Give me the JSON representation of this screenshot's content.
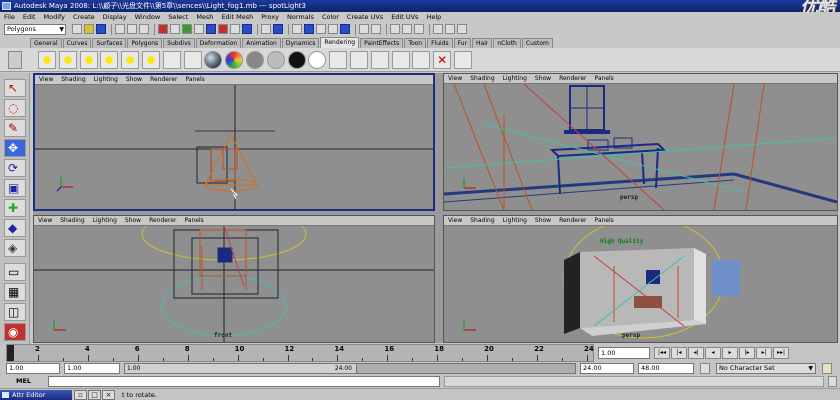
{
  "window": {
    "title": "Autodesk Maya 2008: L:\\\\顧子\\\\光盘文件\\\\第5章\\\\sences\\\\Light_fog1.mb   ---   spotLight3",
    "watermark": "优酷"
  },
  "menubar": [
    "File",
    "Edit",
    "Modify",
    "Create",
    "Display",
    "Window",
    "Select",
    "Mesh",
    "Edit Mesh",
    "Proxy",
    "Normals",
    "Color",
    "Create UVs",
    "Edit UVs",
    "Help"
  ],
  "statusline": {
    "mode": "Polygons",
    "icons": [
      "folder-icon",
      "save-icon",
      "open-icon",
      "snap-grid-icon",
      "snap-curve-icon",
      "snap-point-icon",
      "render-icon",
      "ipr-icon",
      "render-settings-icon"
    ]
  },
  "shelf_tabs": {
    "tabs": [
      "General",
      "Curves",
      "Surfaces",
      "Polygons",
      "Subdivs",
      "Deformation",
      "Animation",
      "Dynamics",
      "Rendering",
      "PaintEffects",
      "Toon",
      "Fluids",
      "Fur",
      "Hair",
      "nCloth",
      "Custom"
    ],
    "active": "Rendering"
  },
  "panel_menu": [
    "View",
    "Shading",
    "Lighting",
    "Show",
    "Renderer",
    "Panels"
  ],
  "viewports": {
    "top_right_label": "persp",
    "bottom_left_label": "front",
    "bottom_right_label": "persp",
    "bottom_right_text": "High Quality"
  },
  "timeslider": {
    "ticks": [
      "2",
      "4",
      "6",
      "8",
      "10",
      "12",
      "14",
      "16",
      "18",
      "20",
      "22",
      "24"
    ],
    "current_time": "1.00",
    "buttons": [
      "|◂◂",
      "|◂",
      "◂|",
      "◂",
      "▸",
      "|▸",
      "▸|",
      "▸▸|"
    ]
  },
  "rangeslider": {
    "start_time": "1.00",
    "playback_start": "1.00",
    "handle_start": "1.00",
    "handle_end": "24.00",
    "playback_end": "24.00",
    "end_time": "48.00",
    "character_set": "No Character Set"
  },
  "cmdline": {
    "label": "MEL"
  },
  "helpline": {
    "task": "Attr Editor",
    "text": "t to rotate."
  }
}
